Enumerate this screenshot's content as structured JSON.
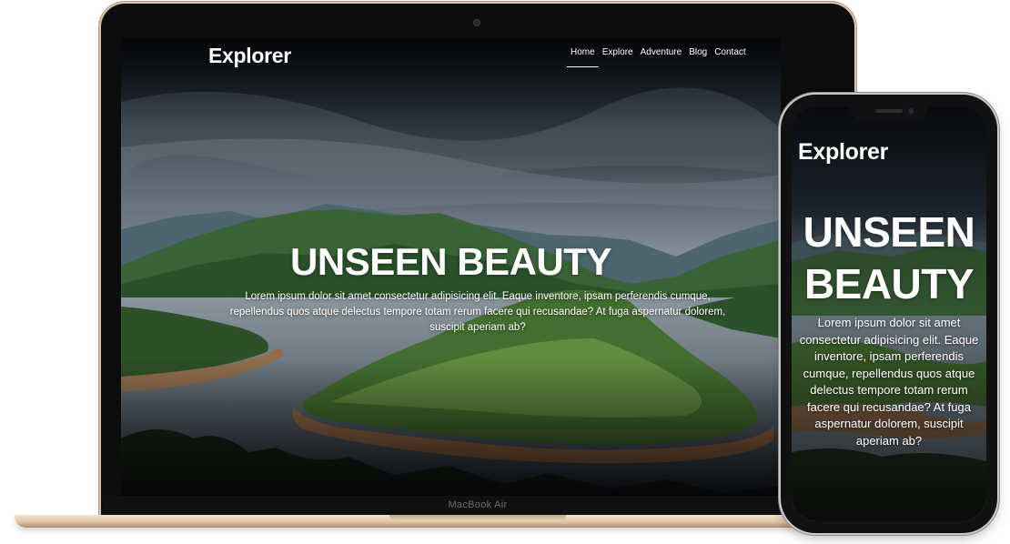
{
  "laptop": {
    "model_label": "MacBook Air"
  },
  "site": {
    "brand": "Explorer",
    "nav": {
      "items": [
        {
          "label": "Home",
          "active": true
        },
        {
          "label": "Explore",
          "active": false
        },
        {
          "label": "Adventure",
          "active": false
        },
        {
          "label": "Blog",
          "active": false
        },
        {
          "label": "Contact",
          "active": false
        }
      ]
    },
    "hero": {
      "title": "UNSEEN BEAUTY",
      "title_line1": "UNSEEN",
      "title_line2": "BEAUTY",
      "text": "Lorem ipsum dolor sit amet consectetur adipisicing elit. Eaque inventore, ipsam perferendis cumque, repellendus quos atque delectus tempore totam rerum facere qui recusandae? At fuga aspernatur dolorem, suscipit aperiam ab?"
    }
  },
  "colors": {
    "text": "#ffffff",
    "laptop_body": "#dcc1a0",
    "bezel": "#0c0c0c"
  }
}
